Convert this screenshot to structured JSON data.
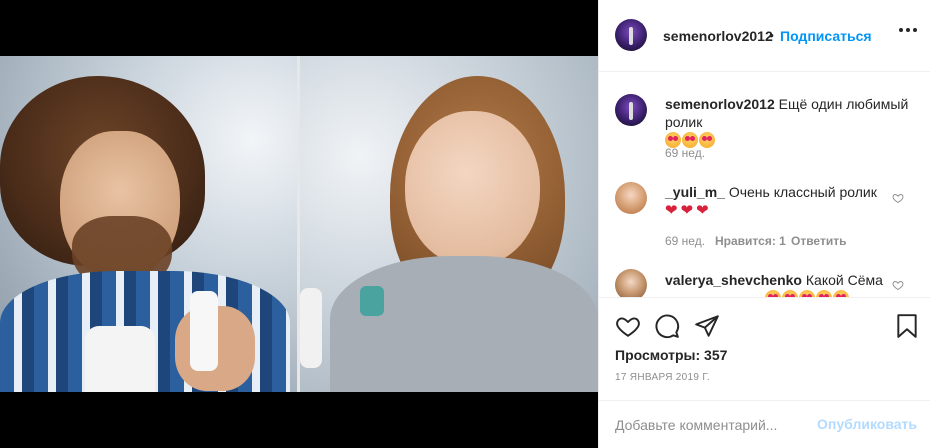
{
  "post": {
    "username": "semenorlov2012",
    "separator": "•",
    "follow_label": "Подписаться",
    "more_icon": "more-horizontal-icon"
  },
  "caption": {
    "username": "semenorlov2012",
    "text": "Ещё один любимый ролик",
    "emojis": [
      "heart-eyes",
      "heart-eyes",
      "heart-eyes"
    ],
    "time": "69 нед."
  },
  "comments": [
    {
      "username": "_yuli_m_",
      "text": "Очень классный ролик",
      "hearts": [
        "red-heart",
        "red-heart",
        "red-heart"
      ],
      "time": "69 нед.",
      "likes": "Нравится: 1",
      "reply": "Ответить"
    },
    {
      "username": "valerya_shevchenko",
      "text": "Какой Сёма"
    }
  ],
  "actions": {
    "like_icon": "heart-icon",
    "comment_icon": "comment-icon",
    "share_icon": "share-icon",
    "save_icon": "bookmark-icon",
    "views_label": "Просмотры:",
    "views_count": "357",
    "views_text": "Просмотры: 357",
    "date": "17 ЯНВАРЯ 2019 Г."
  },
  "add_comment": {
    "placeholder": "Добавьте комментарий...",
    "post_label": "Опубликовать"
  },
  "colors": {
    "accent": "#0095f6",
    "post_disabled": "#b3dbff",
    "muted": "#8e8e8e"
  }
}
